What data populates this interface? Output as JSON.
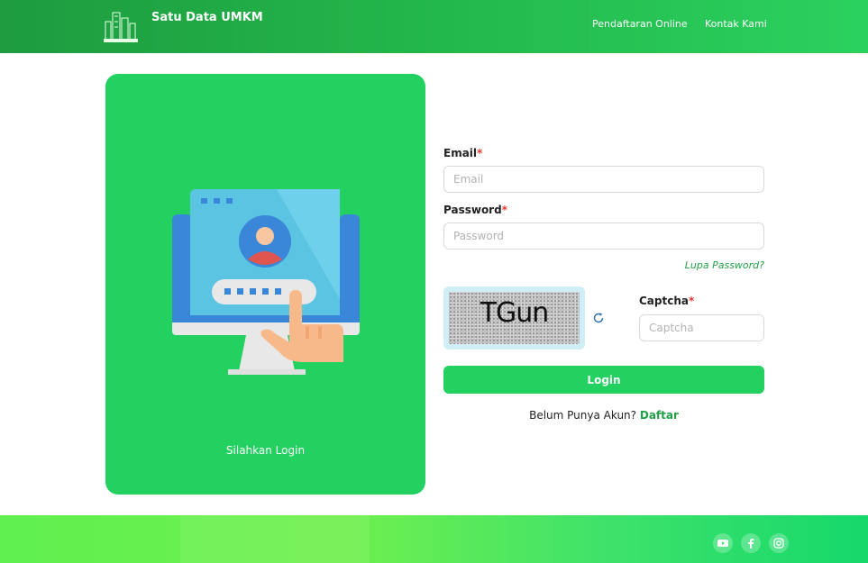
{
  "header": {
    "brand": "Satu Data UMKM",
    "nav": [
      "Pendaftaran Online",
      "Kontak Kami"
    ],
    "logo_icon": "city-buildings-logo"
  },
  "left_card": {
    "caption": "Silahkan Login",
    "illustration_icon": "computer-login-illustration"
  },
  "form": {
    "email_label": "Email",
    "email_placeholder": "Email",
    "email_value": "",
    "password_label": "Password",
    "password_placeholder": "Password",
    "password_value": "",
    "forgot_text": "Lupa Password?",
    "captcha_image_text": "TGun",
    "captcha_label": "Captcha",
    "captcha_placeholder": "Captcha",
    "captcha_value": "",
    "login_label": "Login",
    "register_prompt": "Belum Punya Akun?",
    "register_link": "Daftar",
    "required_marker": "*"
  },
  "footer": {
    "social_icons": [
      "youtube-icon",
      "facebook-icon",
      "instagram-icon"
    ]
  },
  "colors": {
    "primary_green": "#22d160",
    "link_green": "#22a047",
    "required_red": "#e53935"
  }
}
